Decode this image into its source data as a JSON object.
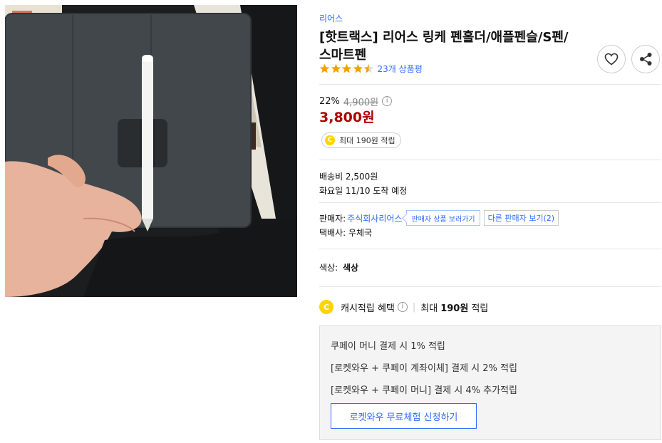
{
  "product": {
    "image_alt": "",
    "brand": "리어스",
    "title_line1": "[핫트랙스] 리어스 링케 펜홀더/애플펜슬/S펜/",
    "title_line2": "스마트펜",
    "rating": 4.5,
    "review_count": "23개 상품평"
  },
  "price": {
    "discount": "22%",
    "original": "4,900원",
    "info_mark": "i",
    "sale": "3,800원",
    "cash_coin": "C",
    "cash_chip": "최대 190원 적립"
  },
  "shipping": {
    "fee": "배송비 2,500원",
    "arrival": "화요일 11/10 도착 예정"
  },
  "seller": {
    "label": "판매자:",
    "name": "주식회사리어스",
    "view_items": "판매자 상품 보러가기",
    "other_sellers": "다른 판매자 보기(2)",
    "courier": "택배사: 우체국"
  },
  "option": {
    "label": "색상:",
    "value": "색상"
  },
  "cash_benefit": {
    "coin": "C",
    "label": "캐시적립 혜택",
    "separator": "|",
    "prefix": "최대",
    "amount": "190원",
    "suffix": "적립"
  },
  "benefits": {
    "line1": "쿠페이 머니 결제 시 1% 적립",
    "line2": "[로켓와우 + 쿠페이 계좌이체] 결제 시 2% 적립",
    "line3": "[로켓와우 + 쿠페이 머니] 결제 시 4% 추가적립",
    "button": "로켓와우 무료체험 신청하기"
  },
  "icons": {
    "favorite": "heart-icon",
    "share": "share-icon",
    "star": "star-icon",
    "info": "info-icon",
    "coin": "cash-coin-icon"
  },
  "colors": {
    "link": "#346aff",
    "sale_price": "#ae0000",
    "star": "#f0a300",
    "coin": "#ffd400"
  }
}
